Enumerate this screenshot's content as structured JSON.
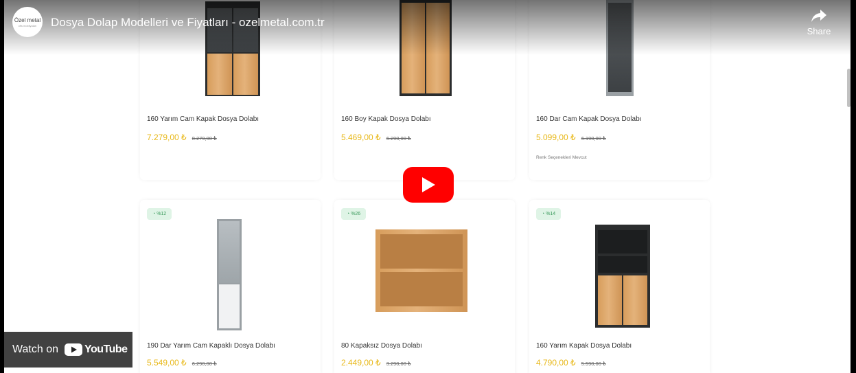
{
  "video": {
    "title": "Dosya Dolap Modelleri ve Fiyatları - ozelmetal.com.tr",
    "channel_logo_text": "Özel metal",
    "channel_logo_sub": "ofis mobilyaları"
  },
  "share": {
    "label": "Share"
  },
  "watch_on": {
    "label": "Watch on",
    "brand": "YouTube"
  },
  "products": [
    {
      "name": "160 Yarım Cam Kapak Dosya Dolabı",
      "price": "7.279,00 ₺",
      "old_price": "8.279,00 ₺"
    },
    {
      "name": "160 Boy Kapak Dosya Dolabı",
      "price": "5.469,00 ₺",
      "old_price": "6.290,00 ₺"
    },
    {
      "name": "160 Dar Cam Kapak Dosya Dolabı",
      "price": "5.099,00 ₺",
      "old_price": "6.190,00 ₺",
      "note": "Renk Seçenekleri Mevcut"
    },
    {
      "badge": "%12",
      "name": "190 Dar Yarım Cam Kapaklı Dosya Dolabı",
      "price": "5.549,00 ₺",
      "old_price": "6.290,00 ₺"
    },
    {
      "badge": "%26",
      "name": "80 Kapaksız Dosya Dolabı",
      "price": "2.449,00 ₺",
      "old_price": "3.290,00 ₺"
    },
    {
      "badge": "%14",
      "name": "160 Yarım Kapak Dosya Dolabı",
      "price": "4.790,00 ₺",
      "old_price": "5.590,00 ₺"
    }
  ],
  "colors": {
    "price": "#e8b818",
    "play": "#ff0000",
    "badge_bg": "#dff4e6",
    "badge_text": "#3a9a5c"
  }
}
